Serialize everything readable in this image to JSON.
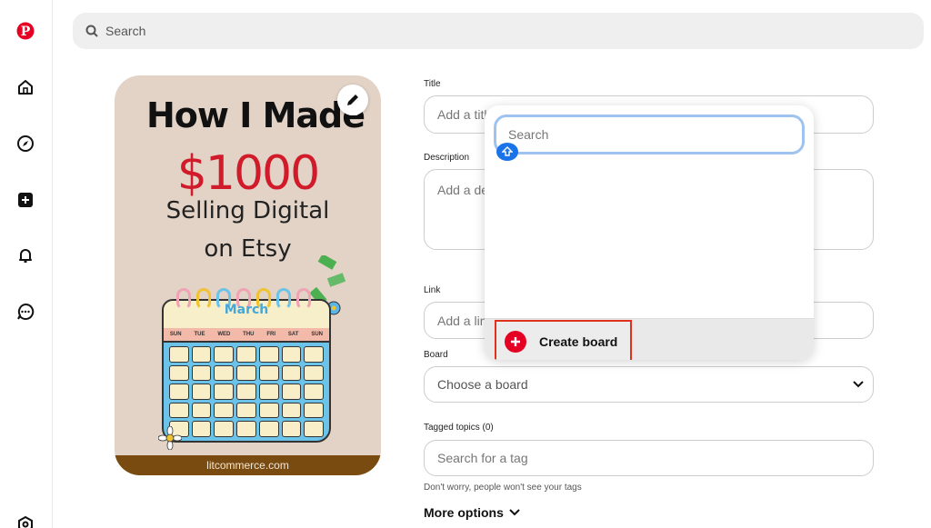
{
  "sidebar": {
    "items": [
      {
        "name": "pinterest-logo",
        "icon": "pinterest-icon"
      },
      {
        "name": "home",
        "icon": "home-icon"
      },
      {
        "name": "explore",
        "icon": "compass-icon"
      },
      {
        "name": "create",
        "icon": "plus-square-icon"
      },
      {
        "name": "notifications",
        "icon": "bell-icon"
      },
      {
        "name": "messages",
        "icon": "chat-icon"
      },
      {
        "name": "settings",
        "icon": "settings-icon"
      }
    ]
  },
  "search": {
    "placeholder": "Search"
  },
  "pin": {
    "title": "How I Made",
    "amount": "$1000",
    "line1": "Selling Digital",
    "line2": "on Etsy",
    "calendar_month": "March",
    "calendar_days": [
      "SUN",
      "TUE",
      "WED",
      "THU",
      "FRI",
      "SAT",
      "SUN"
    ],
    "footer": "litcommerce.com"
  },
  "form": {
    "title_label": "Title",
    "title_placeholder": "Add a title",
    "description_label": "Description",
    "description_placeholder": "Add a detailed description",
    "link_label": "Link",
    "link_placeholder": "Add a link",
    "board_label": "Board",
    "board_placeholder": "Choose a board",
    "tags_label": "Tagged topics (0)",
    "tags_placeholder": "Search for a tag",
    "tags_hint": "Don't worry, people won't see your tags",
    "more_options": "More options"
  },
  "board_dropdown": {
    "search_placeholder": "Search",
    "create_board_label": "Create board"
  },
  "colors": {
    "pinterest_red": "#e60023",
    "highlight_red": "#e0301e",
    "focus_blue": "#9fc3f0"
  }
}
